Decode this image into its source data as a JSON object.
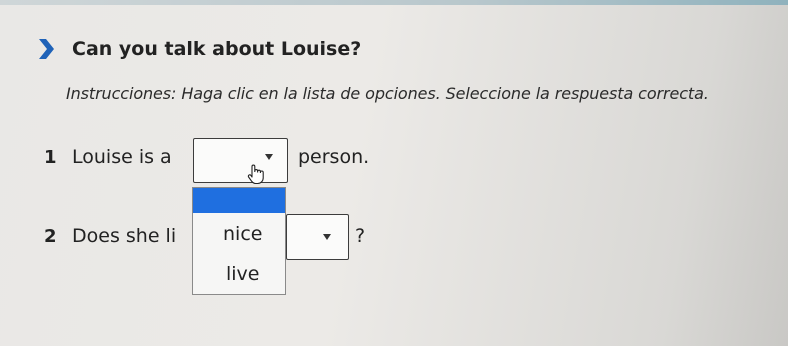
{
  "section": {
    "title": "Can you talk about Louise?",
    "chevron_icon": "chevron-right-icon",
    "accent": "#1f62b8"
  },
  "instructions": "Instrucciones: Haga clic en la lista de opciones. Seleccione la respuesta correcta.",
  "questions": [
    {
      "number": "1",
      "before": "Louise is a",
      "after": "person.",
      "selected": ""
    },
    {
      "number": "2",
      "before": "Does she li",
      "after": "?",
      "selected": ""
    }
  ],
  "dropdown": {
    "options": [
      "",
      "nice",
      "live"
    ],
    "highlighted_color": "#1f6fe0"
  },
  "cursor_icon": "hand-pointer-icon"
}
